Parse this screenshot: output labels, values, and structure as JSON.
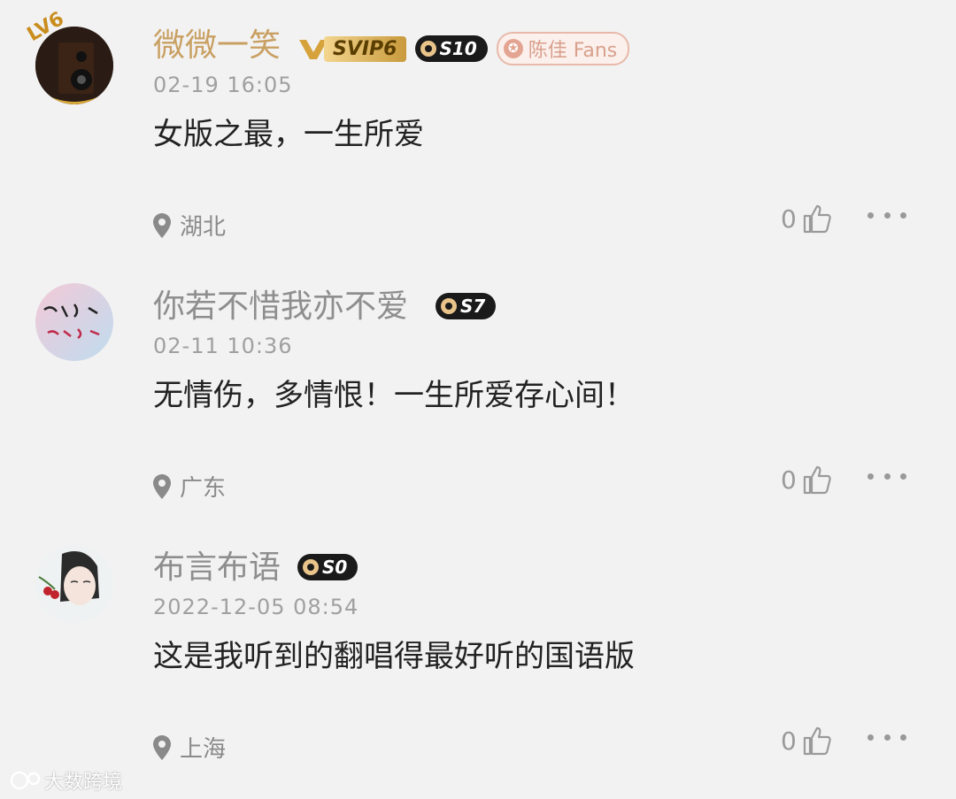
{
  "comments": [
    {
      "nickname": "微微一笑",
      "level_badge": "LV6",
      "svip_badge": "SVIP6",
      "s_badge": "S10",
      "fans_badge": "陈佳 Fans",
      "time": "02-19 16:05",
      "text": "女版之最，一生所爱",
      "location": "湖北",
      "likes": "0"
    },
    {
      "nickname": "你若不惜我亦不爱",
      "s_badge": "S7",
      "time": "02-11 10:36",
      "text": "无情伤，多情恨！一生所爱存心间！",
      "location": "广东",
      "likes": "0"
    },
    {
      "nickname": "布言布语",
      "s_badge": "S0",
      "time": "2022-12-05 08:54",
      "text": "这是我听到的翻唱得最好听的国语版",
      "location": "上海",
      "likes": "0"
    }
  ],
  "watermark": "大数跨境",
  "colors": {
    "background": "#f2f2f2",
    "nickname_gold": "#c9a063",
    "nickname_gray": "#8e8e8e",
    "text": "#222222"
  }
}
